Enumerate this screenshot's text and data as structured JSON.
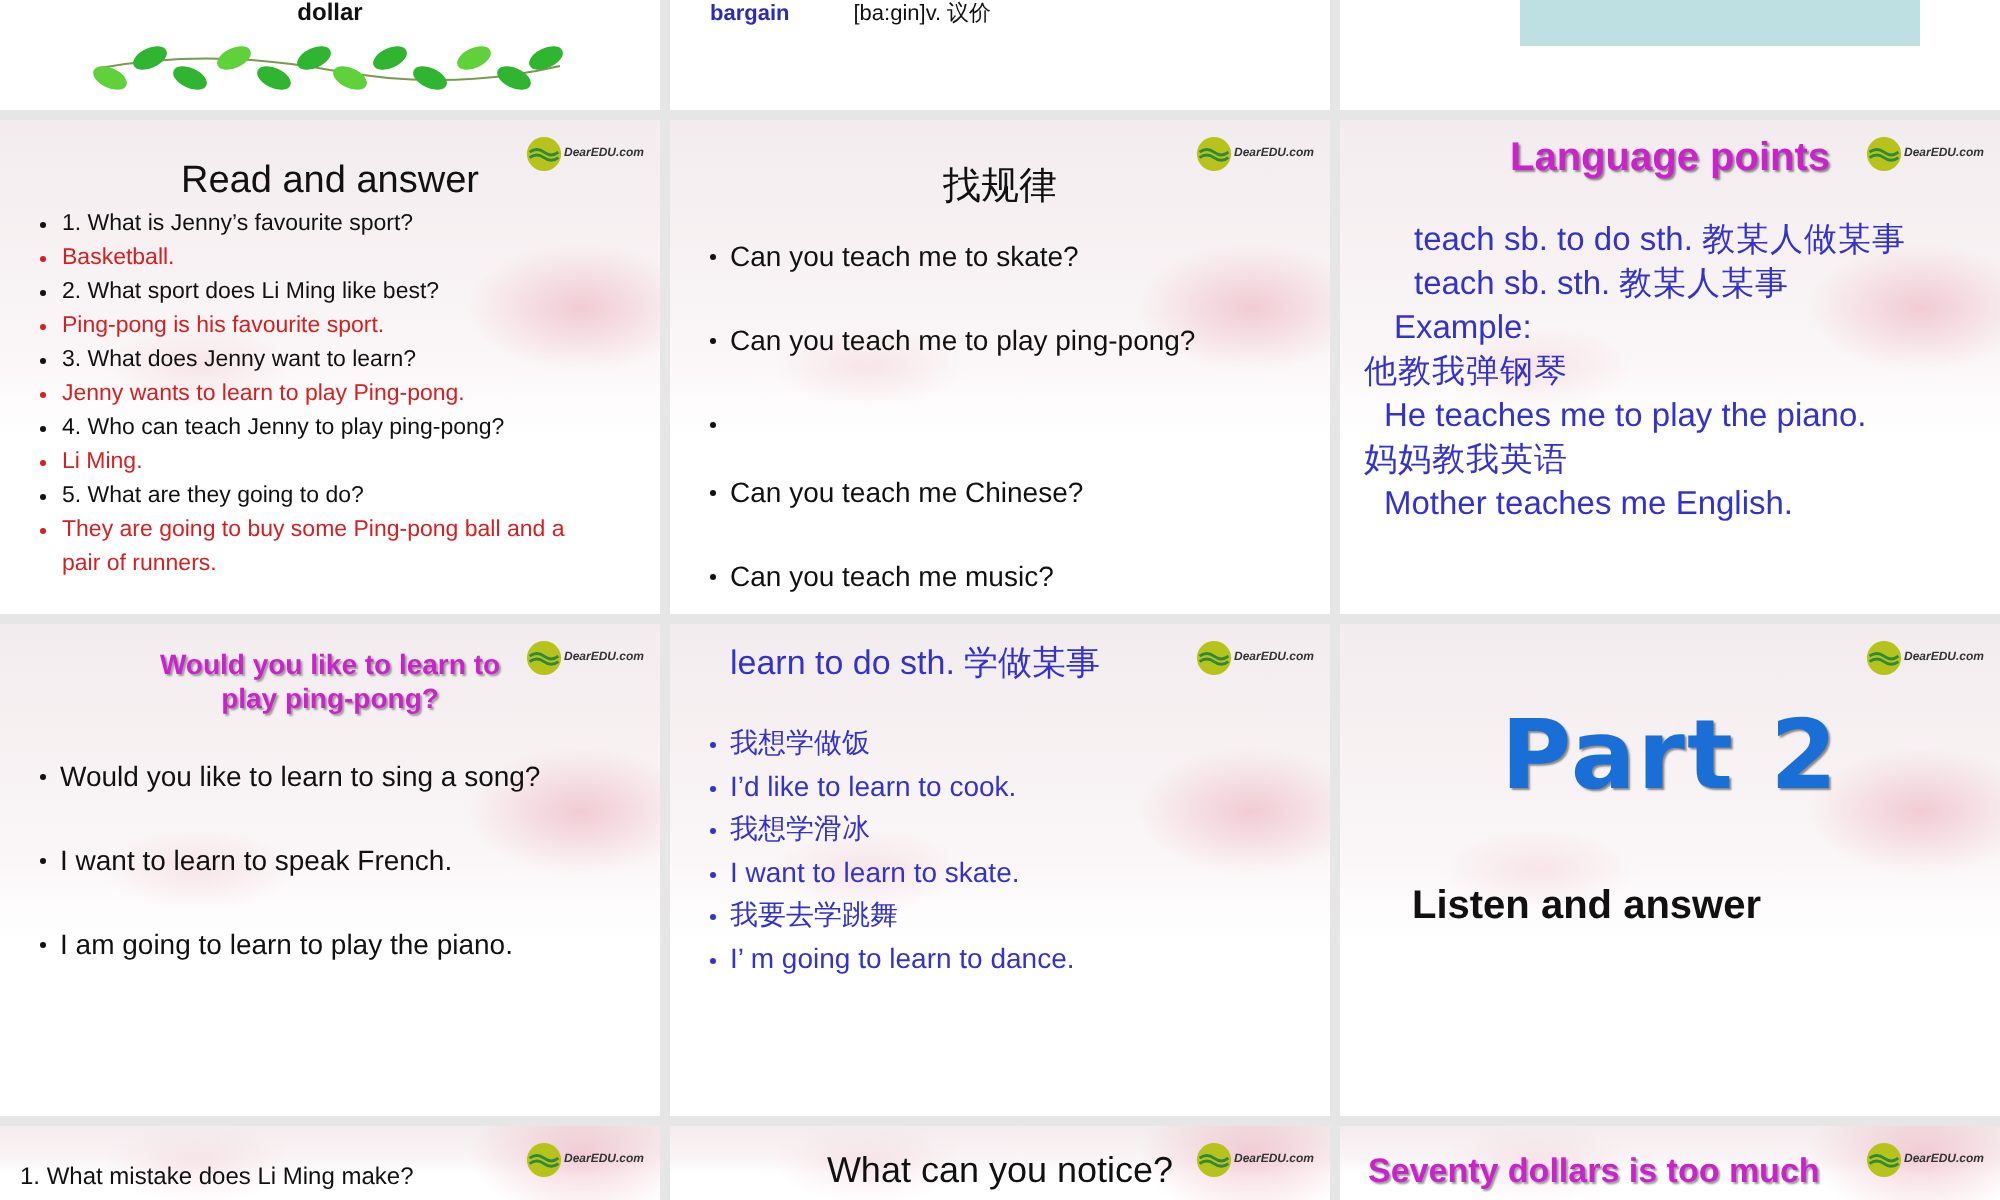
{
  "slides": [
    {
      "kind": "vine",
      "text": "dollar"
    },
    {
      "kind": "vocab",
      "lines": [
        {
          "text": "bargain",
          "color": "#2b2bb8"
        },
        {
          "text": "[ba:gin]v. 议价",
          "color": "#111111"
        }
      ]
    },
    {
      "kind": "panel"
    },
    {
      "kind": "dense",
      "title": {
        "text": "Read and answer",
        "color": "#111111"
      },
      "logo": "DearEDU.com",
      "lines": [
        {
          "text": "1. What is Jenny’s favourite sport?",
          "color": "#111111",
          "bullet": true
        },
        {
          "text": "Basketball.",
          "color": "#d42020",
          "bullet": true
        },
        {
          "text": "2. What sport does Li Ming like best?",
          "color": "#111111",
          "bullet": true
        },
        {
          "text": "Ping-pong is his favourite sport.",
          "color": "#d42020",
          "bullet": true
        },
        {
          "text": "3. What does Jenny want to learn?",
          "color": "#111111",
          "bullet": true
        },
        {
          "text": "Jenny wants to learn to play Ping-pong.",
          "color": "#d42020",
          "bullet": true
        },
        {
          "text": "4. Who can teach Jenny to play ping-pong?",
          "color": "#111111",
          "bullet": true
        },
        {
          "text": "Li Ming.",
          "color": "#d42020",
          "bullet": true
        },
        {
          "text": "5. What are they going to do?",
          "color": "#111111",
          "bullet": true
        },
        {
          "text": "They are going to buy some Ping-pong ball and a pair of runners.",
          "color": "#d42020",
          "bullet": true
        }
      ]
    },
    {
      "kind": "sparse",
      "title": {
        "text": "找规律",
        "color": "#111111"
      },
      "logo": "DearEDU.com",
      "lines": [
        {
          "text": "Can you teach me to skate?",
          "color": "#111111",
          "bullet": true
        },
        {
          "text": "Can you teach me to play ping-pong?",
          "color": "#111111",
          "bullet": true
        },
        {
          "bullet": true
        },
        {
          "text": "Can you teach me Chinese?",
          "color": "#111111",
          "bullet": true
        },
        {
          "text": "Can you teach me music?",
          "color": "#111111",
          "bullet": true
        }
      ]
    },
    {
      "kind": "points",
      "title": {
        "text": "Language points",
        "color": "#cc22cc"
      },
      "logo": "DearEDU.com",
      "lines": [
        {
          "text": "teach sb. to do sth. 教某人做某事",
          "color": "#3333cc",
          "bullet": false
        },
        {
          "text": "teach sb. sth. 教某人某事",
          "color": "#3333cc",
          "bullet": false
        },
        {
          "text": "Example:",
          "color": "#3333cc",
          "bullet": false
        },
        {
          "text": "他教我弹钢琴",
          "color": "#3333cc",
          "bullet": false
        },
        {
          "text": "He teaches me to play the piano.",
          "color": "#3333cc",
          "bullet": false
        },
        {
          "text": "妈妈教我英语",
          "color": "#3333cc",
          "bullet": false
        },
        {
          "text": "Mother teaches me English.",
          "color": "#3333cc",
          "bullet": false
        }
      ]
    },
    {
      "kind": "sparse",
      "title": {
        "text": "Would you like to learn to play ping-pong?",
        "color": "#cc22cc"
      },
      "logo": "DearEDU.com",
      "lines": [
        {
          "text": "Would you like to learn to sing a song?",
          "color": "#111111",
          "bullet": true
        },
        {
          "text": "I want to learn to speak French.",
          "color": "#111111",
          "bullet": true
        },
        {
          "text": "I am going to learn to play the piano.",
          "color": "#111111",
          "bullet": true
        }
      ]
    },
    {
      "kind": "list",
      "title": {
        "text": "learn to do sth. 学做某事",
        "color": "#3333cc"
      },
      "logo": "DearEDU.com",
      "lines": [
        {
          "text": "我想学做饭",
          "color": "#3333cc",
          "bullet": true
        },
        {
          "text": "I’d like to learn to cook.",
          "color": "#3333cc",
          "bullet": true
        },
        {
          "text": "我想学滑冰",
          "color": "#3333cc",
          "bullet": true
        },
        {
          "text": "I want to learn to skate.",
          "color": "#3333cc",
          "bullet": true
        },
        {
          "text": "我要去学跳舞",
          "color": "#3333cc",
          "bullet": true
        },
        {
          "text": "I’ m going to learn to dance.",
          "color": "#3333cc",
          "bullet": true
        }
      ]
    },
    {
      "kind": "part",
      "title": {
        "text": "Part 2",
        "color": "#1a6fd6"
      },
      "logo": "DearEDU.com",
      "lines": [
        {
          "text": "Listen and answer",
          "color": "#111111"
        }
      ]
    },
    {
      "kind": "cut",
      "logo": "DearEDU.com",
      "lines": [
        {
          "text": "1. What mistake does Li Ming make?",
          "color": "#111111"
        }
      ]
    },
    {
      "kind": "cut",
      "title": {
        "text": "What can you notice?",
        "color": "#111111"
      },
      "logo": "DearEDU.com"
    },
    {
      "kind": "cut",
      "title": {
        "text": "Seventy dollars is too much",
        "color": "#cc22cc"
      },
      "logo": "DearEDU.com"
    }
  ]
}
